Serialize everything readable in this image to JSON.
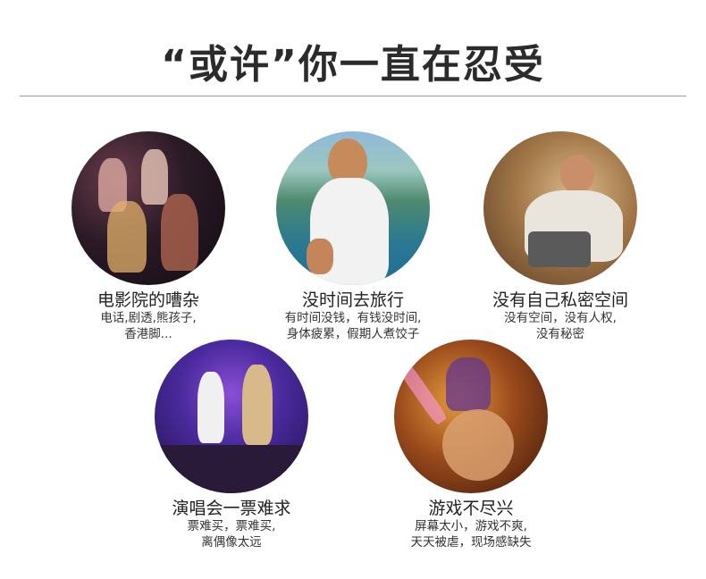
{
  "title": "“或许”你一直在忍受",
  "items": [
    {
      "caption": "电影院的嘈杂",
      "line1": "电话,剧透,熊孩子,",
      "line2": "香港脚..."
    },
    {
      "caption": "没时间去旅行",
      "line1": "有时间没钱，有钱没时间,",
      "line2": "身体疲累，假期人煮饺子"
    },
    {
      "caption": "没有自己私密空间",
      "line1": "没有空间，没有人权,",
      "line2": "没有秘密"
    },
    {
      "caption": "演唱会一票难求",
      "line1": "票难买，票难买,",
      "line2": "离偶像太远"
    },
    {
      "caption": "游戏不尽兴",
      "line1": "屏幕太小，游戏不爽,",
      "line2": "天天被虐，现场感缺失"
    }
  ]
}
